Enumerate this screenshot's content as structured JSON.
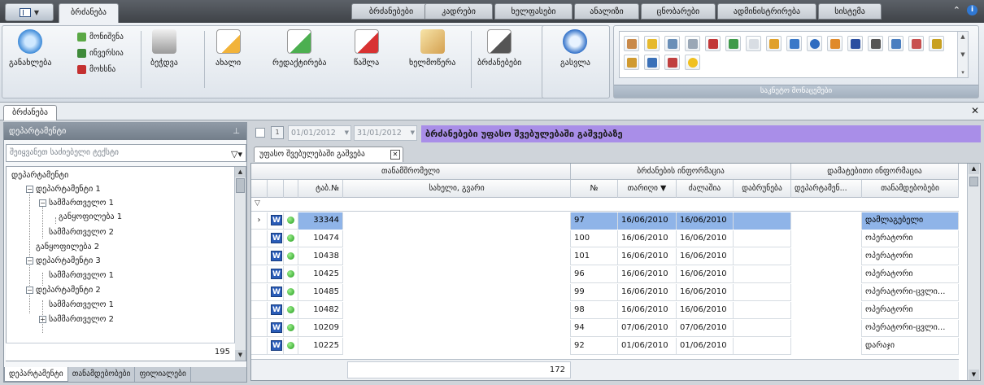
{
  "ribbon_tabs": [
    "ბრძანება",
    "ბრძანებები",
    "კადრები",
    "ხელფასები",
    "ანალიზი",
    "ცნობარები",
    "ადმინისტრირება",
    "სისტემა"
  ],
  "ribbon": {
    "refresh_label": "განახლება",
    "mark_label": "მონიშვნა",
    "invert_label": "ინვერსია",
    "remove_label": "მოხსნა",
    "print_label": "ბეჭდვა",
    "new_label": "ახალი",
    "edit_label": "რედაქტირება",
    "delete_label": "წაშლა",
    "sign_label": "ხელმოწერა",
    "orders_label": "ბრძანებები",
    "exit_label": "გასვლა",
    "reference_group_label": "საკნეტო მონაცემები"
  },
  "doc_tab": "ბრძანება",
  "left_panel": {
    "title": "დეპარტამენტი",
    "search_placeholder": "შეიყვანეთ საძიებელი ტექსტი",
    "tree": [
      {
        "label": "დეპარტამენტი",
        "level": 0
      },
      {
        "label": "დეპარტამენტი 1",
        "level": 1
      },
      {
        "label": "სამმართველო 1",
        "level": 2
      },
      {
        "label": "განყოფილება 1",
        "level": 3
      },
      {
        "label": "სამმართველო 2",
        "level": 2
      },
      {
        "label": "განყოფილება 2",
        "level": 1
      },
      {
        "label": "დეპარტამენტი 3",
        "level": 1
      },
      {
        "label": "სამმართველო 1",
        "level": 2
      },
      {
        "label": "დეპარტამენტი 2",
        "level": 1
      },
      {
        "label": "სამმართველო 1",
        "level": 2
      },
      {
        "label": "სამმართველო 2",
        "level": 2
      }
    ],
    "count": "195",
    "bottom_tabs": [
      "დეპარტამენტი",
      "თანამდებობები",
      "ფილიალები"
    ]
  },
  "filter": {
    "date_from": "01/01/2012",
    "date_to": "31/01/2012",
    "title": "ბრძანებები უფასო შვებულებაში გაშვებაზე"
  },
  "grid_tab": "უფასო შვებულებაში გაშვება",
  "grid": {
    "bands": [
      "თანამშრომელი",
      "ბრძანების ინფორმაცია",
      "დამატებითი ინფორმაცია"
    ],
    "headers": [
      "ტაბ.№",
      "სახელი, გვარი",
      "№",
      "თარიღი",
      "ძალაშია",
      "დაბრუნება",
      "დეპარტამენ...",
      "თანამდებობები"
    ],
    "rows": [
      {
        "tab": "33344",
        "name": "",
        "no": "97",
        "date": "16/06/2010",
        "active": "16/06/2010",
        "ret": "",
        "dept": "",
        "pos": "დამლაგებელი"
      },
      {
        "tab": "10474",
        "name": "",
        "no": "100",
        "date": "16/06/2010",
        "active": "16/06/2010",
        "ret": "",
        "dept": "",
        "pos": "ოპერატორი"
      },
      {
        "tab": "10438",
        "name": "",
        "no": "101",
        "date": "16/06/2010",
        "active": "16/06/2010",
        "ret": "",
        "dept": "",
        "pos": "ოპერატორი"
      },
      {
        "tab": "10425",
        "name": "",
        "no": "96",
        "date": "16/06/2010",
        "active": "16/06/2010",
        "ret": "",
        "dept": "",
        "pos": "ოპერატორი"
      },
      {
        "tab": "10485",
        "name": "",
        "no": "99",
        "date": "16/06/2010",
        "active": "16/06/2010",
        "ret": "",
        "dept": "",
        "pos": "ოპერატორი-ცვლი..."
      },
      {
        "tab": "10482",
        "name": "",
        "no": "98",
        "date": "16/06/2010",
        "active": "16/06/2010",
        "ret": "",
        "dept": "",
        "pos": "ოპერატორი"
      },
      {
        "tab": "10209",
        "name": "",
        "no": "94",
        "date": "07/06/2010",
        "active": "07/06/2010",
        "ret": "",
        "dept": "",
        "pos": "ოპერატორი-ცვლი..."
      },
      {
        "tab": "10225",
        "name": "",
        "no": "92",
        "date": "01/06/2010",
        "active": "01/06/2010",
        "ret": "",
        "dept": "",
        "pos": "დარაჯი"
      }
    ],
    "total": "172",
    "row_icon_letter": "W"
  },
  "colors": {
    "title_bar": "#a98ee8",
    "selection": "#8fb4e8",
    "header_dark": "#3e4247"
  }
}
